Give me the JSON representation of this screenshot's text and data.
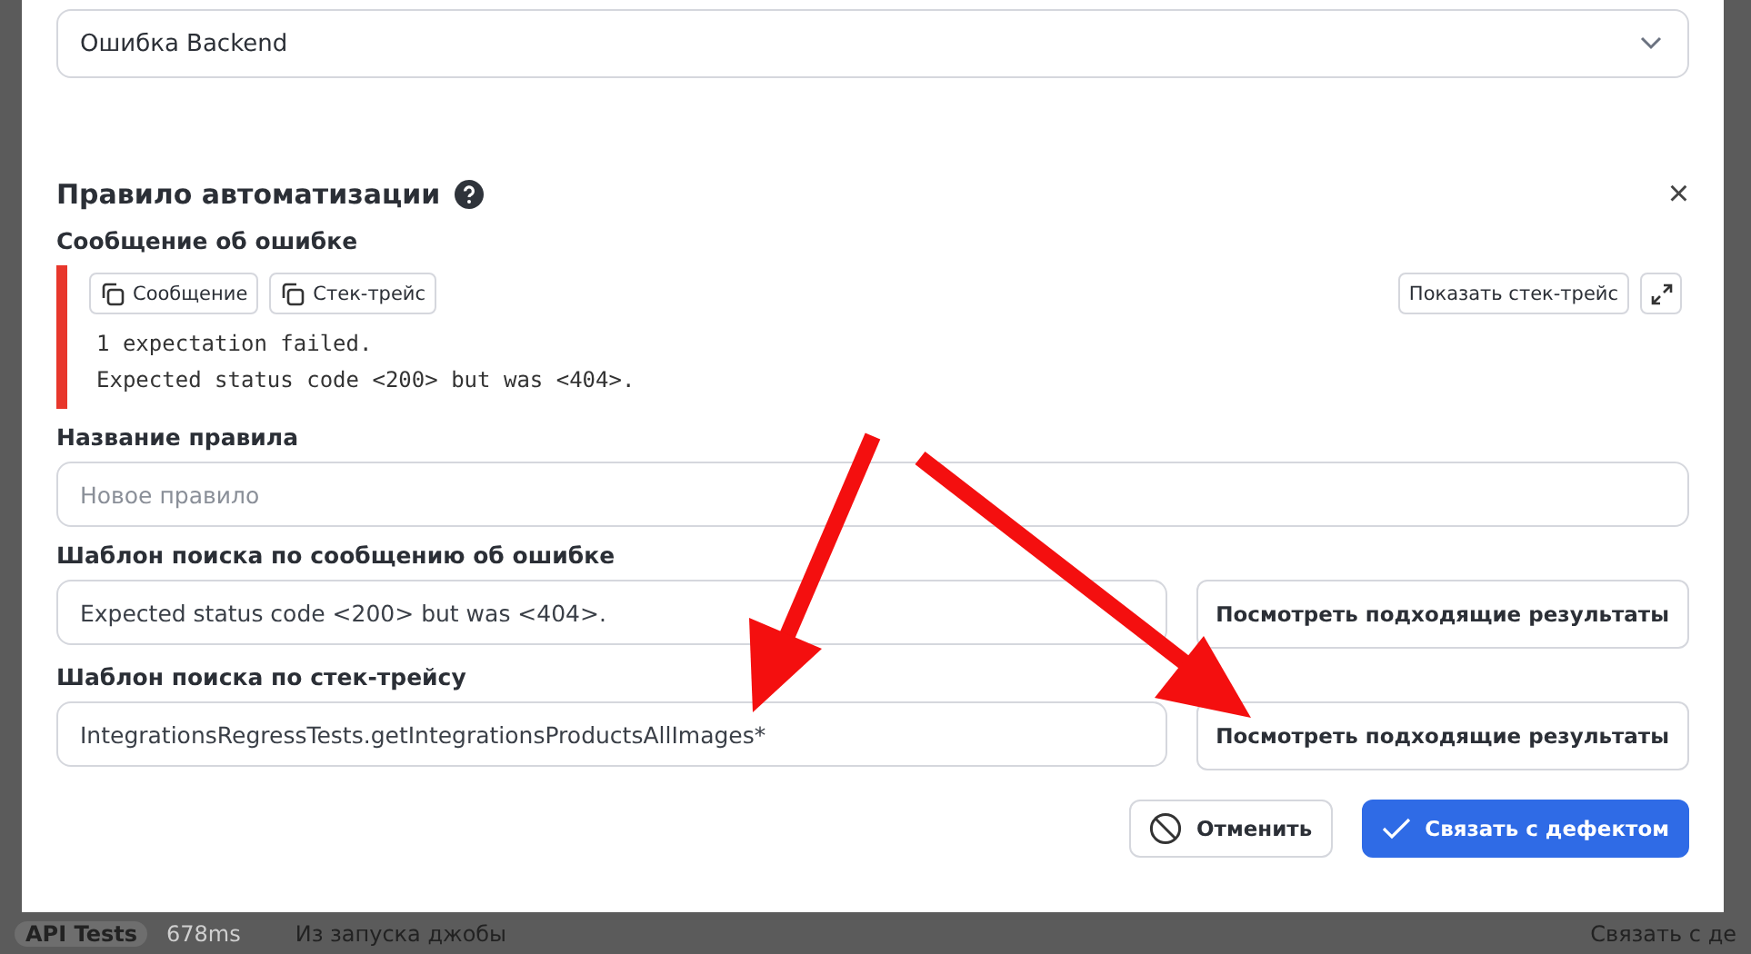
{
  "category_select": {
    "value": "Ошибка Backend"
  },
  "dialog": {
    "title": "Правило автоматизации",
    "close": "×"
  },
  "error_message": {
    "label": "Сообщение об ошибке",
    "copy_buttons": [
      "Сообщение",
      "Стек-трейс"
    ],
    "show_stack_button": "Показать стек-трейс",
    "lines": [
      "1 expectation failed.",
      "Expected status code <200> but was <404>."
    ]
  },
  "fields": [
    {
      "label": "Название правила",
      "placeholder": "Новое правило"
    },
    {
      "label": "Шаблон поиска по сообщению об ошибке",
      "value": "Expected status code <200> but was <404>.",
      "button": "Посмотреть подходящие результаты"
    },
    {
      "label": "Шаблон поиска по стек-трейсу",
      "value": "IntegrationsRegressTests.getIntegrationsProductsAllImages*",
      "button": "Посмотреть подходящие результаты"
    }
  ],
  "buttons": {
    "cancel": "Отменить",
    "confirm": "Связать с дефектом"
  },
  "background": {
    "tag": "API Tests",
    "duration": "678ms",
    "text": "Из запуска джобы",
    "action": "Связать с де"
  }
}
